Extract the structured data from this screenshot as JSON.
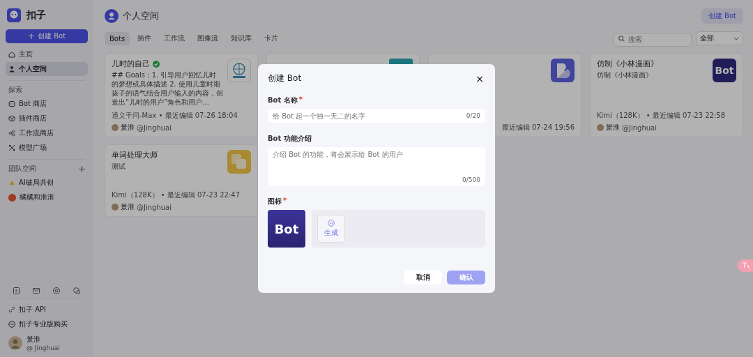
{
  "sidebar": {
    "brand": "扣子",
    "create_button": {
      "icon": "+",
      "label": "创建 Bot"
    },
    "nav": [
      {
        "label": "主页",
        "selected": false
      },
      {
        "label": "个人空间",
        "selected": true
      }
    ],
    "explore_title": "探索",
    "explore": [
      {
        "label": "Bot 商店"
      },
      {
        "label": "插件商店"
      },
      {
        "label": "工作流商店"
      },
      {
        "label": "模型广场"
      }
    ],
    "team_title": "团队空间",
    "teams": [
      {
        "label": "AI破局共创"
      },
      {
        "label": "橘橘和淮淮"
      }
    ],
    "links": [
      {
        "label": "扣子 API"
      },
      {
        "label": "扣子专业版购买"
      }
    ],
    "user": {
      "name": "景淮",
      "handle": "@ Jinghuai"
    }
  },
  "header": {
    "title": "个人空间",
    "create_button": "创建 Bot"
  },
  "tabs": [
    {
      "label": "Bots",
      "selected": true
    },
    {
      "label": "插件",
      "selected": false
    },
    {
      "label": "工作流",
      "selected": false
    },
    {
      "label": "图像流",
      "selected": false
    },
    {
      "label": "知识库",
      "selected": false
    },
    {
      "label": "卡片",
      "selected": false
    }
  ],
  "search": {
    "placeholder": "搜索"
  },
  "filter": {
    "value": "全部"
  },
  "cards": [
    {
      "title": "儿时的自己",
      "verified": true,
      "description": "## Goals : 1. 引导用户回忆儿时的梦想或具体描述 2. 使用儿童时期孩子的语气结合用户输入的内容，创造出“儿时的用户”角色和用户...",
      "meta": "通义千问-Max • 最近编辑 07-26 18:04",
      "author": "景淮",
      "handle": "@Jinghuai",
      "thumb": {
        "kind": "globe"
      }
    },
    {
      "thumb": {
        "kind": "teal"
      }
    },
    {
      "meta": "最近编辑 07-24 19:56",
      "thumb": {
        "kind": "b-logo"
      }
    },
    {
      "title": "仿制《小林漫画》",
      "verified": false,
      "description": "仿制《小林漫画》",
      "meta": "Kimi（128K） • 最近编辑 07-23 22:58",
      "author": "景淮",
      "handle": "@Jinghuai",
      "thumb": {
        "kind": "text",
        "text": "Bot"
      }
    },
    {
      "title": "单词处理大师",
      "verified": false,
      "description": "测试",
      "meta": "Kimi（128K） • 最近编辑 07-23 22:47",
      "author": "景淮",
      "handle": "@Jinghuai",
      "thumb": {
        "kind": "squares"
      }
    }
  ],
  "dialog": {
    "title": "创建 Bot",
    "close": "×",
    "name_label": "Bot 名称",
    "name_required_mark": "*",
    "name_placeholder": "给 Bot 起一个独一无二的名字",
    "name_counter": "0/20",
    "desc_label": "Bot 功能介绍",
    "desc_placeholder": "介绍 Bot 的功能，将会展示给 Bot 的用户",
    "desc_counter": "0/500",
    "icon_label": "图标",
    "icon_required_mark": "*",
    "icon_preview": "Bot",
    "generate": "生成",
    "cancel": "取消",
    "confirm": {
      "label": "确认",
      "disabled": true
    }
  }
}
